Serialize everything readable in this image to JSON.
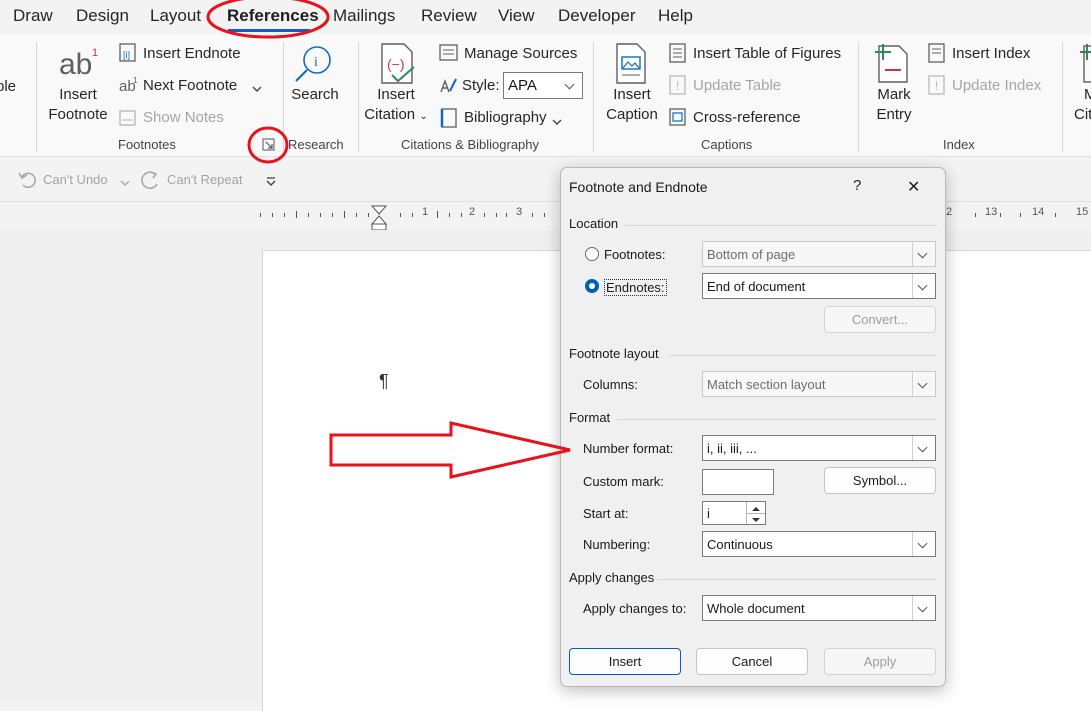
{
  "menu": {
    "tabs": [
      "Draw",
      "Design",
      "Layout",
      "References",
      "Mailings",
      "Review",
      "View",
      "Developer",
      "Help"
    ],
    "active": "References"
  },
  "ribbon": {
    "left_fragment": "ble",
    "footnotes": {
      "insert_footnote_line1": "Insert",
      "insert_footnote_line2": "Footnote",
      "insert_endnote": "Insert Endnote",
      "next_footnote": "Next Footnote",
      "show_notes": "Show Notes",
      "group_label": "Footnotes"
    },
    "research": {
      "search": "Search",
      "group_label": "Research"
    },
    "citations": {
      "insert_citation_line1": "Insert",
      "insert_citation_line2": "Citation",
      "manage_sources": "Manage Sources",
      "style_label": "Style:",
      "style_value": "APA",
      "bibliography": "Bibliography",
      "group_label": "Citations & Bibliography"
    },
    "captions": {
      "insert_caption_line1": "Insert",
      "insert_caption_line2": "Caption",
      "insert_table_of_figures": "Insert Table of Figures",
      "update_table": "Update Table",
      "cross_reference": "Cross-reference",
      "group_label": "Captions"
    },
    "index": {
      "mark_entry_line1": "Mark",
      "mark_entry_line2": "Entry",
      "insert_index": "Insert Index",
      "update_index": "Update Index",
      "group_label": "Index"
    },
    "right_fragment_line1": "M",
    "right_fragment_line2": "Cit"
  },
  "qat": {
    "undo": "Can't Undo",
    "repeat": "Can't Repeat"
  },
  "ruler": {
    "left_numbers": [
      "1",
      "2",
      "3"
    ],
    "right_numbers": [
      "2",
      "13",
      "14",
      "15"
    ]
  },
  "document": {
    "pilcrow": "¶"
  },
  "dialog": {
    "title": "Footnote and Endnote",
    "help": "?",
    "close": "✕",
    "location": {
      "heading": "Location",
      "footnotes_label": "Footnotes:",
      "footnotes_value": "Bottom of page",
      "endnotes_label": "Endnotes:",
      "endnotes_value": "End of document",
      "selected": "endnotes",
      "convert": "Convert..."
    },
    "layout": {
      "heading": "Footnote layout",
      "columns_label": "Columns:",
      "columns_value": "Match section layout"
    },
    "format": {
      "heading": "Format",
      "number_format_label": "Number format:",
      "number_format_value": "i, ii, iii, ...",
      "custom_mark_label": "Custom mark:",
      "custom_mark_value": "",
      "symbol": "Symbol...",
      "start_at_label": "Start at:",
      "start_at_value": "i",
      "numbering_label": "Numbering:",
      "numbering_value": "Continuous"
    },
    "apply": {
      "heading": "Apply changes",
      "apply_to_label": "Apply changes to:",
      "apply_to_value": "Whole document"
    },
    "buttons": {
      "insert": "Insert",
      "cancel": "Cancel",
      "apply": "Apply"
    }
  },
  "colors": {
    "annotation_red": "#e8121b",
    "accent": "#185abd"
  }
}
